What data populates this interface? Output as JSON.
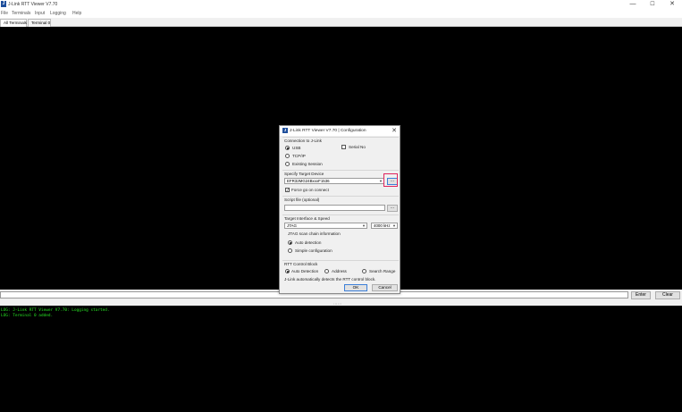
{
  "window": {
    "title": "J-Link RTT Viewer V7.70",
    "app_icon": "J",
    "minimize_glyph": "—",
    "maximize_glyph": "☐",
    "close_glyph": "✕"
  },
  "menu": {
    "items": [
      "File",
      "Terminals",
      "Input",
      "Logging",
      "Help"
    ]
  },
  "tabs": [
    {
      "label": "All Terminals",
      "active": true
    },
    {
      "label": "Terminal 0",
      "active": false
    }
  ],
  "input_row": {
    "enter_label": "Enter",
    "clear_label": "Clear"
  },
  "splitter_grip": "::::::",
  "log": {
    "lines": [
      "LOG: J-Link RTT Viewer V7.70: Logging started.",
      "LOG: Terminal 0 added."
    ],
    "color": "#27e023"
  },
  "dialog": {
    "title": "J-Link RTT Viewer V7.70 | Configuration",
    "icon": "J",
    "close_glyph": "✕",
    "connection": {
      "heading": "Connection to J-Link",
      "usb_label": "USB",
      "serial_label": "Serial No",
      "tcpip_label": "TCP/IP",
      "existing_label": "Existing Session",
      "selected": "USB"
    },
    "target": {
      "heading": "Specify Target Device",
      "device_value": "EFR32MG24BxxxF1536",
      "browse_label": "...",
      "force_go_label": "Force go on connect",
      "force_go_checked": true,
      "checkmark": "✓"
    },
    "script": {
      "heading": "Script file (optional)",
      "value": "",
      "browse_label": "..."
    },
    "interface": {
      "heading": "Target Interface & Speed",
      "interface_value": "JTAG",
      "speed_value": "4000 kHz",
      "scan_chain_heading": "JTAG scan chain information",
      "auto_label": "Auto detection",
      "simple_label": "Simple configuration",
      "selected": "Auto detection"
    },
    "rtt_block": {
      "heading": "RTT Control Block",
      "auto_label": "Auto Detection",
      "address_label": "Address",
      "search_label": "Search Range",
      "selected": "Auto Detection",
      "note": "J-Link automatically detects the RTT control block."
    },
    "ok_label": "OK",
    "cancel_label": "Cancel"
  },
  "colors": {
    "terminal_bg": "#000000",
    "highlight": "#e0245e",
    "focus": "#3c7fd8"
  }
}
